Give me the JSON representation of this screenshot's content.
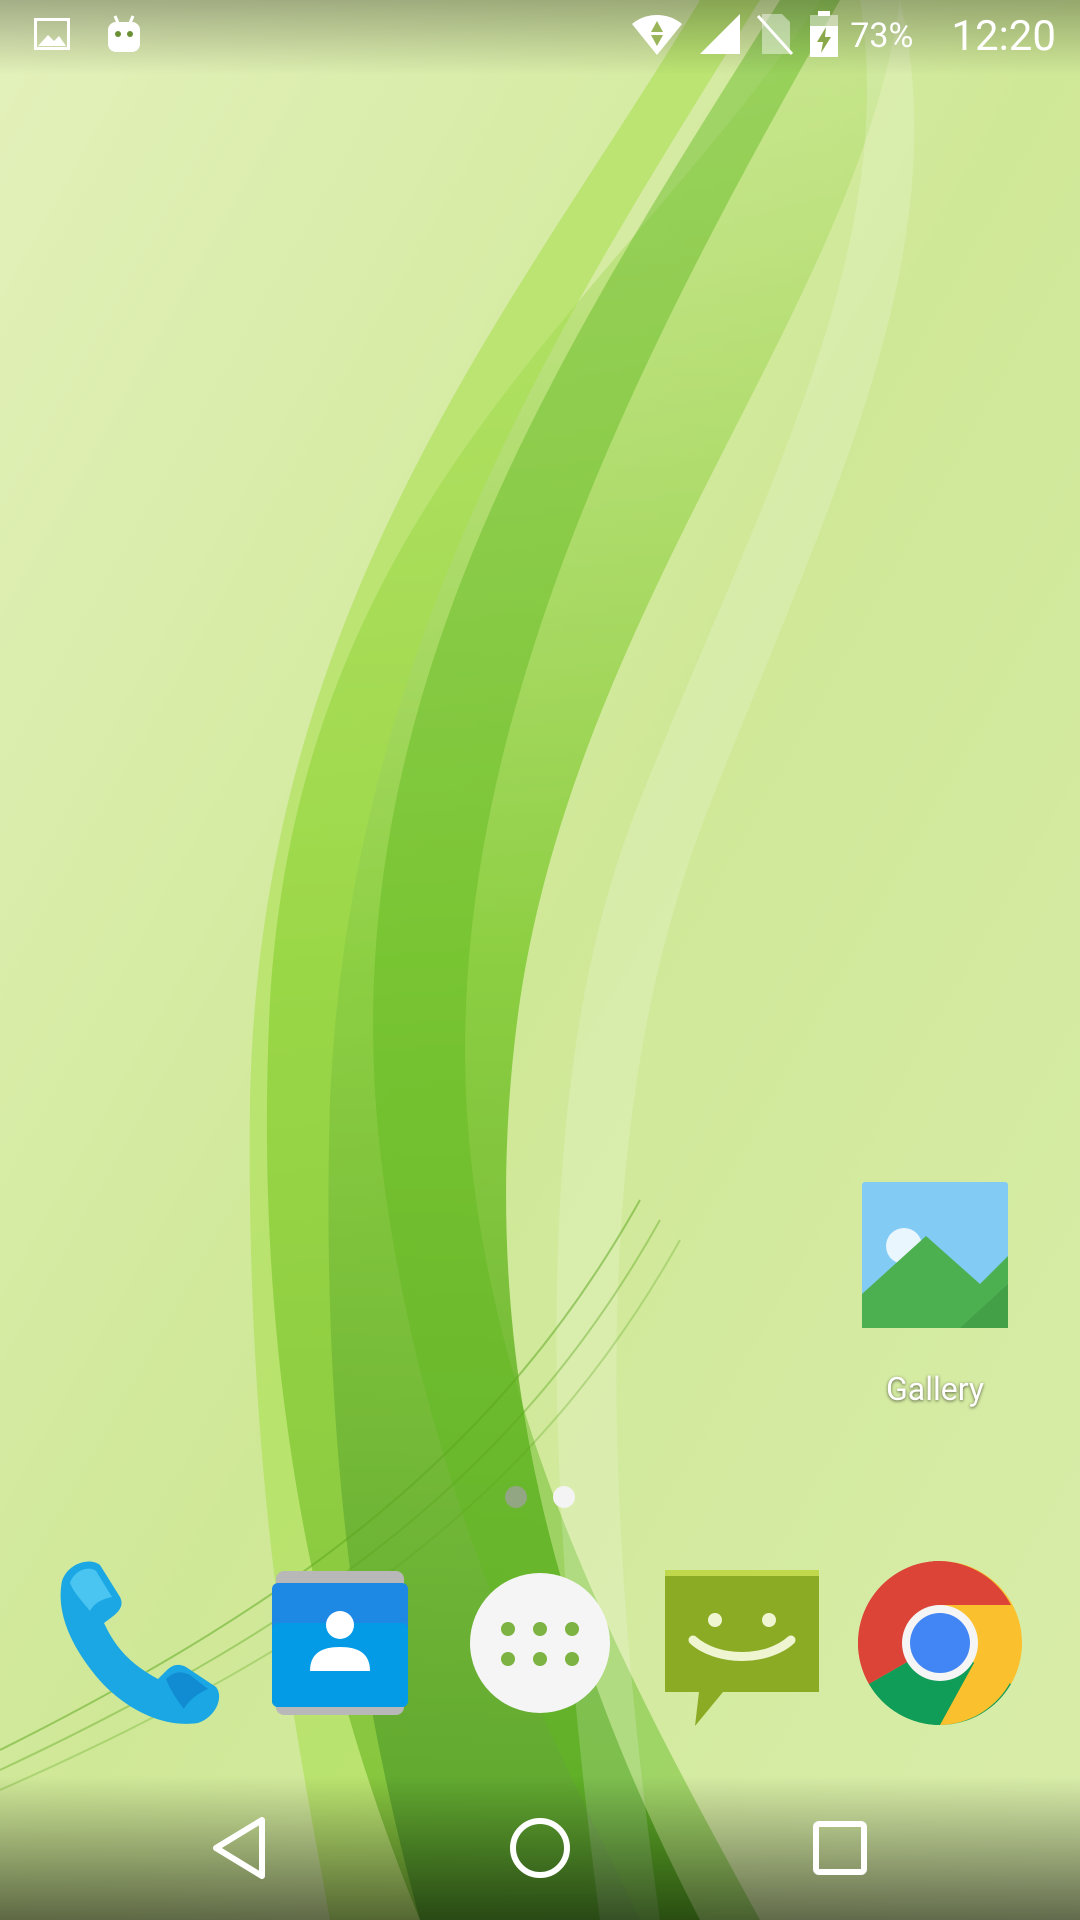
{
  "status_bar": {
    "battery_percent": "73%",
    "time": "12:20",
    "notification_icons": [
      "image-icon",
      "android-icon"
    ],
    "system_icons": [
      "wifi-icon",
      "cell-signal-icon",
      "no-sim-icon",
      "battery-charging-icon"
    ]
  },
  "home": {
    "shortcuts": [
      {
        "label": "Gallery",
        "icon": "gallery-icon"
      }
    ],
    "pages": {
      "count": 2,
      "current": 2
    }
  },
  "dock": {
    "apps": [
      {
        "icon": "phone-icon"
      },
      {
        "icon": "contacts-icon"
      },
      {
        "icon": "app-drawer-icon"
      },
      {
        "icon": "messaging-icon"
      },
      {
        "icon": "chrome-icon"
      }
    ]
  },
  "navigation": {
    "buttons": [
      "back-icon",
      "home-icon",
      "recents-icon"
    ]
  },
  "colors": {
    "wallpaper_base": "#d6ec9f",
    "wallpaper_accent": "#6cc524",
    "phone_blue": "#1ba9e6",
    "contacts_blue": "#1e88e5",
    "messaging_green": "#8bab24",
    "chrome_red": "#db4437",
    "chrome_yellow": "#fbc02d",
    "chrome_green": "#0f9d58",
    "chrome_blue": "#4285f4"
  }
}
